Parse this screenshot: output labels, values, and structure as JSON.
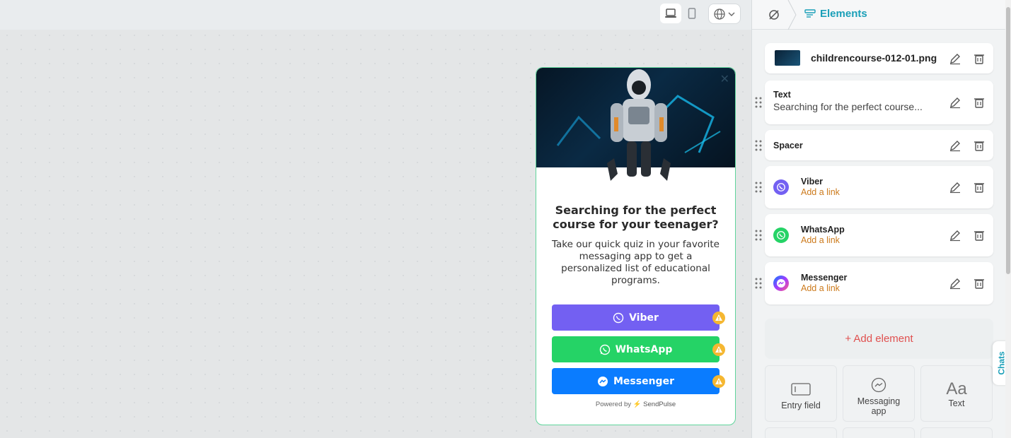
{
  "canvas": {
    "widget": {
      "title": "Searching for the perfect course for your teenager?",
      "description": "Take our quick quiz in your favorite messaging app to get a personalized list of educational programs.",
      "buttons": [
        {
          "label": "Viber",
          "color": "#7360f2",
          "icon": "viber-icon"
        },
        {
          "label": "WhatsApp",
          "color": "#25d366",
          "icon": "whatsapp-icon"
        },
        {
          "label": "Messenger",
          "color": "#0a7cff",
          "icon": "messenger-icon"
        }
      ],
      "powered_by": "Powered by",
      "brand": "SendPulse"
    }
  },
  "panel": {
    "breadcrumb": "Elements",
    "image_card": {
      "filename": "childrencourse-012-01.png"
    },
    "text_card": {
      "label": "Text",
      "value": "Searching for the perfect course..."
    },
    "spacer_card": {
      "label": "Spacer"
    },
    "messengers": [
      {
        "label": "Viber",
        "sub": "Add a link",
        "color": "#7360f2"
      },
      {
        "label": "WhatsApp",
        "sub": "Add a link",
        "color": "#25d366"
      },
      {
        "label": "Messenger",
        "sub": "Add a link",
        "color": "#0a7cff"
      }
    ],
    "add_element": "+ Add element",
    "tiles": [
      {
        "label": "Entry field",
        "icon": "entry-field-icon"
      },
      {
        "label": "Messaging app",
        "icon": "messaging-app-icon"
      },
      {
        "label": "Text",
        "icon": "text-icon",
        "glyph": "Aa"
      }
    ],
    "chats_tab": "Chats"
  },
  "colors": {
    "accent": "#1a9fb8",
    "add": "#e0504f",
    "link": "#cc7a1c",
    "widget_border": "#5fd59b"
  }
}
